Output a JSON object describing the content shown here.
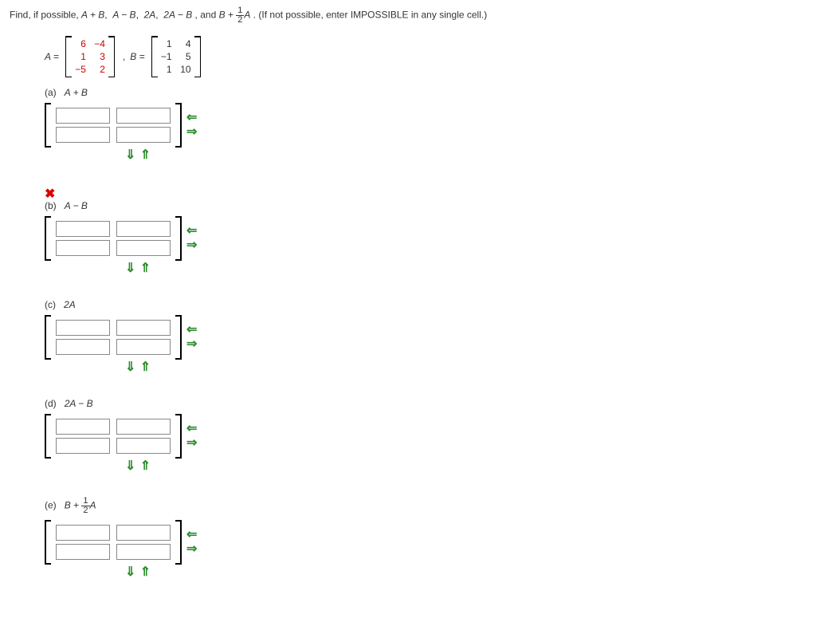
{
  "prompt": {
    "pre": "Find, if possible, ",
    "list_html_parts": [
      "A + B",
      "A − B",
      "2A",
      "2A − B"
    ],
    "and": ", and ",
    "last_expr_prefix": "B + ",
    "frac_num": "1",
    "frac_den": "2",
    "last_expr_suffix": "A",
    "post": ". (If not possible, enter IMPOSSIBLE in any single cell.)"
  },
  "matrixA": {
    "label": "A =",
    "cells": [
      "6",
      "−4",
      "1",
      "3",
      "−5",
      "2"
    ]
  },
  "matrixB": {
    "label": "B =",
    "cells": [
      "1",
      "4",
      "−1",
      "5",
      "1",
      "10"
    ]
  },
  "comma": ",",
  "parts": {
    "a": {
      "label": "(a)",
      "expr": "A + B"
    },
    "b": {
      "label": "(b)",
      "expr": "A − B"
    },
    "c": {
      "label": "(c)",
      "expr": "2A"
    },
    "d": {
      "label": "(d)",
      "expr": "2A − B"
    },
    "e": {
      "label": "(e)",
      "expr_prefix": "B + ",
      "frac_num": "1",
      "frac_den": "2",
      "expr_suffix": "A"
    }
  },
  "icons": {
    "left_arrow": "⇐",
    "right_arrow": "⇒",
    "down_arrow": "⇓",
    "up_arrow": "⇑",
    "x": "✖"
  }
}
